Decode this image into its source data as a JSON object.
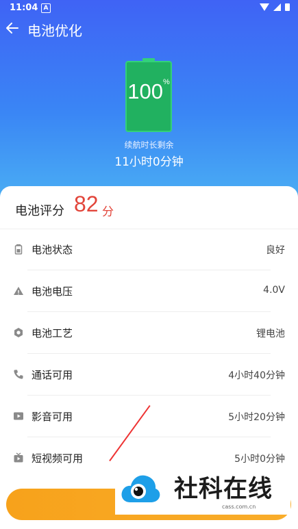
{
  "status_bar": {
    "time": "11:04",
    "notification_badge": "A"
  },
  "app_bar": {
    "title": "电池优化",
    "back_icon": "arrow-left-icon"
  },
  "battery": {
    "level_percent": "100",
    "percent_sign": "%",
    "fill_fraction": 1.0,
    "color": "#21b160"
  },
  "endurance": {
    "label": "续航时长剩余",
    "value": "11小时0分钟"
  },
  "score": {
    "label": "电池评分",
    "value": "82",
    "unit": "分",
    "color": "#e2453a"
  },
  "rows": [
    {
      "icon": "battery-icon",
      "label": "电池状态",
      "value": "良好"
    },
    {
      "icon": "warning-icon",
      "label": "电池电压",
      "value": "4.0V"
    },
    {
      "icon": "hexagon-icon",
      "label": "电池工艺",
      "value": "锂电池"
    },
    {
      "icon": "phone-icon",
      "label": "通话可用",
      "value": "4小时40分钟"
    },
    {
      "icon": "play-icon",
      "label": "影音可用",
      "value": "5小时20分钟"
    },
    {
      "icon": "short-video-icon",
      "label": "短视频可用",
      "value": "5小时0分钟"
    }
  ],
  "action_button": {
    "color": "#f7a21b"
  },
  "watermark": {
    "text": "社科在线",
    "url": "cass.com.cn"
  },
  "colors": {
    "hero_top": "#3f63f5",
    "hero_bottom": "#4bb0f3",
    "icon_gray": "#8a8a8a"
  }
}
